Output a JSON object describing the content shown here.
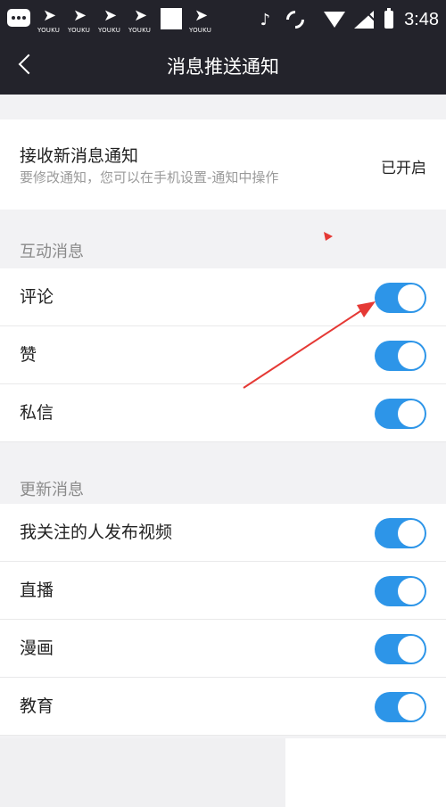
{
  "status_bar": {
    "youku_label": "YOUKU",
    "time": "3:48"
  },
  "nav": {
    "title": "消息推送通知"
  },
  "receive": {
    "title": "接收新消息通知",
    "subtitle": "要修改通知，您可以在手机设置-通知中操作",
    "status": "已开启"
  },
  "sections": {
    "interactive": {
      "header": "互动消息",
      "items": [
        {
          "label": "评论",
          "on": true
        },
        {
          "label": "赞",
          "on": true
        },
        {
          "label": "私信",
          "on": true
        }
      ]
    },
    "updates": {
      "header": "更新消息",
      "items": [
        {
          "label": "我关注的人发布视频",
          "on": true
        },
        {
          "label": "直播",
          "on": true
        },
        {
          "label": "漫画",
          "on": true
        },
        {
          "label": "教育",
          "on": true
        }
      ]
    }
  },
  "colors": {
    "toggle_on": "#2d95e8",
    "header_bg": "#23232b",
    "annotation": "#e53935"
  }
}
